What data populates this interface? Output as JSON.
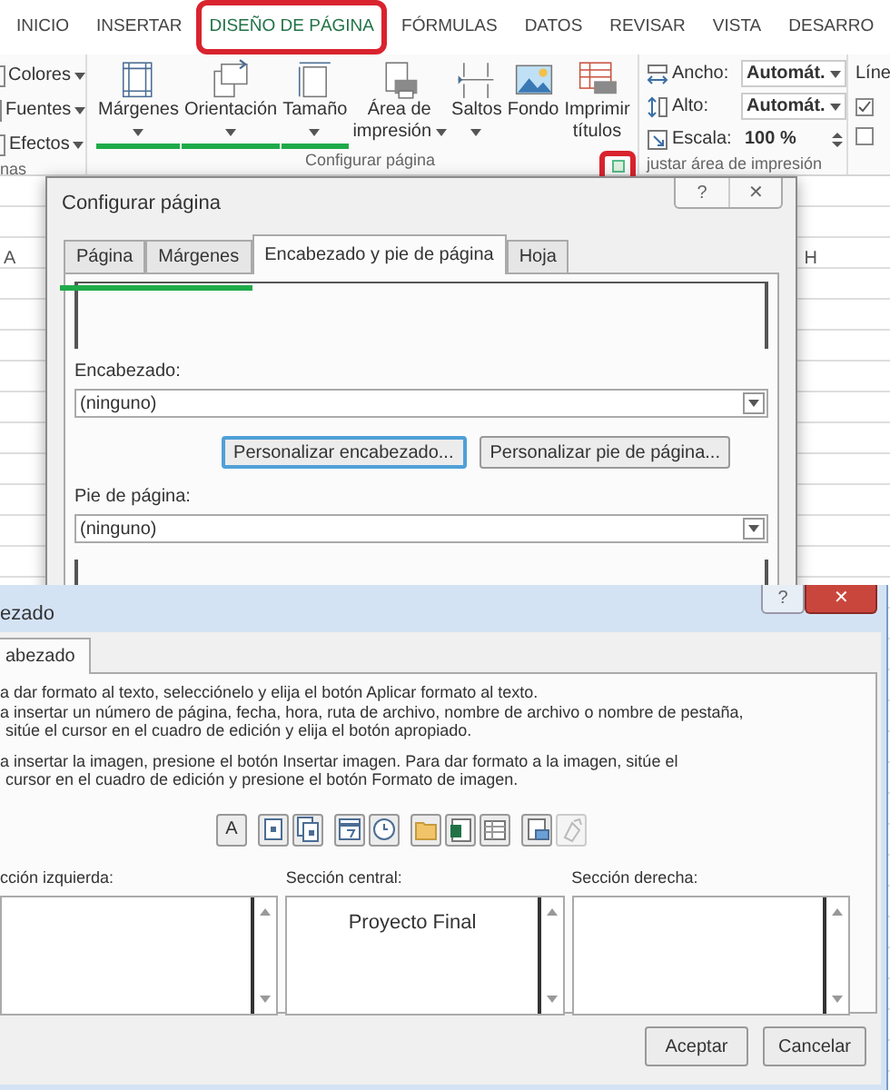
{
  "ribbon": {
    "tabs": [
      {
        "label": "INICIO",
        "selected": false,
        "circled": false
      },
      {
        "label": "INSERTAR",
        "selected": false,
        "circled": false
      },
      {
        "label": "DISEÑO DE PÁGINA",
        "selected": true,
        "circled": true
      },
      {
        "label": "FÓRMULAS",
        "selected": false,
        "circled": false
      },
      {
        "label": "DATOS",
        "selected": false,
        "circled": false
      },
      {
        "label": "REVISAR",
        "selected": false,
        "circled": false
      },
      {
        "label": "VISTA",
        "selected": false,
        "circled": false
      },
      {
        "label": "DESARRO",
        "selected": false,
        "circled": false
      }
    ],
    "themes_group": {
      "label": "nas",
      "items": [
        {
          "label": "Colores"
        },
        {
          "label": "Fuentes"
        },
        {
          "label": "Efectos"
        }
      ]
    },
    "page_group": {
      "label": "Configurar página",
      "launcher_circled": true,
      "buttons": [
        {
          "kind": "margins",
          "lines": [
            "Márgenes"
          ],
          "dropdown": true,
          "underlined": true
        },
        {
          "kind": "orientation",
          "lines": [
            "Orientación"
          ],
          "dropdown": true,
          "underlined": true
        },
        {
          "kind": "size",
          "lines": [
            "Tamaño"
          ],
          "dropdown": true,
          "underlined": true
        },
        {
          "kind": "print-area",
          "lines": [
            "Área de",
            "impresión"
          ],
          "dropdown": true,
          "underlined": false
        },
        {
          "kind": "breaks",
          "lines": [
            "Saltos"
          ],
          "dropdown": true,
          "underlined": false
        },
        {
          "kind": "background",
          "lines": [
            "Fondo"
          ],
          "dropdown": false,
          "underlined": false
        },
        {
          "kind": "print-titles",
          "lines": [
            "Imprimir",
            "títulos"
          ],
          "dropdown": false,
          "underlined": false
        }
      ]
    },
    "scale_group": {
      "label": "justar área de impresión",
      "rows": [
        {
          "kind": "width",
          "label": "Ancho:",
          "value": "Automát."
        },
        {
          "kind": "height",
          "label": "Alto:",
          "value": "Automát."
        },
        {
          "kind": "scale",
          "label": "Escala:",
          "value": "100 %"
        }
      ]
    },
    "sheet_options_group": {
      "label": "Líne",
      "items": [
        {
          "checked": true
        },
        {
          "checked": false
        }
      ]
    }
  },
  "sheet": {
    "columns": [
      "A",
      "H"
    ]
  },
  "page_setup_dialog": {
    "title": "Configurar página",
    "controls": [
      "?",
      "✕"
    ],
    "tabs": [
      {
        "label": "Página",
        "selected": false,
        "underlined": true
      },
      {
        "label": "Márgenes",
        "selected": false,
        "underlined": true
      },
      {
        "label": "Encabezado y pie de página",
        "selected": true,
        "underlined": false
      },
      {
        "label": "Hoja",
        "selected": false,
        "underlined": false
      }
    ],
    "header_label": "Encabezado:",
    "header_value": "(ninguno)",
    "buttons": [
      {
        "label": "Personalizar encabezado...",
        "focused": true
      },
      {
        "label": "Personalizar pie de página...",
        "focused": false
      }
    ],
    "footer_label": "Pie de página:",
    "footer_value": "(ninguno)"
  },
  "header_dialog": {
    "title": "ezado",
    "controls": [
      {
        "kind": "help",
        "label": "?"
      },
      {
        "kind": "close",
        "label": "✕"
      }
    ],
    "tabs": [
      {
        "label": "abezado",
        "selected": true
      }
    ],
    "instructions": [
      {
        "kind": "first",
        "text": "a dar formato al texto, selecciónelo y elija el botón Aplicar formato al texto."
      },
      {
        "kind": "first",
        "text": "a insertar un número de página, fecha, hora, ruta de archivo, nombre de archivo o nombre de pestaña,"
      },
      {
        "kind": "continuation",
        "text": "sitúe el cursor en el cuadro de edición y elija el botón apropiado."
      },
      {
        "kind": "first",
        "text": "a insertar la imagen, presione el botón Insertar imagen. Para dar formato a la imagen, sitúe el"
      },
      {
        "kind": "continuation",
        "text": "cursor en el cuadro de edición y presione el botón Formato de imagen."
      }
    ],
    "tool_groups": [
      [
        {
          "kind": "font",
          "label": "A",
          "disabled": false
        }
      ],
      [
        {
          "kind": "page-number",
          "disabled": false
        },
        {
          "kind": "page-count",
          "disabled": false
        }
      ],
      [
        {
          "kind": "date",
          "disabled": false
        },
        {
          "kind": "time",
          "disabled": false
        }
      ],
      [
        {
          "kind": "file-path",
          "disabled": false
        },
        {
          "kind": "file-name",
          "disabled": false
        },
        {
          "kind": "sheet-name",
          "disabled": false
        }
      ],
      [
        {
          "kind": "picture",
          "disabled": false
        },
        {
          "kind": "picture-format",
          "disabled": true
        }
      ]
    ],
    "sections": [
      {
        "label": "cción izquierda:"
      },
      {
        "label": "Sección central:",
        "value": "Proyecto Final"
      },
      {
        "label": "Sección derecha:"
      }
    ],
    "buttons": [
      "Aceptar",
      "Cancelar"
    ]
  }
}
